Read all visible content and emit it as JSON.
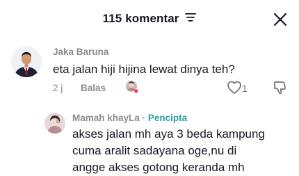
{
  "header": {
    "comment_count_title": "115 komentar",
    "sort_icon": "sort-filter-icon",
    "close_icon": "close-icon"
  },
  "comment": {
    "username": "Jaka Baruna",
    "text": "eta jalan hiji hijina lewat dinya teh?",
    "time": "2 j",
    "reply_label": "Balas",
    "like_count": "1",
    "like_icon": "heart-outline-icon",
    "dislike_icon": "thumbs-down-icon"
  },
  "reply": {
    "username": "Mamah khayLa",
    "separator": "·",
    "badge": "Pencipta",
    "text_lines": [
      "akses jalan mh aya 3 beda kampung",
      "cuma aralit sadayana oge,nu di",
      "angge akses gotong keranda mh"
    ]
  },
  "colors": {
    "creator_badge": "#2b9e97",
    "muted_text": "#8a8b91",
    "heart": "#fe2c55"
  }
}
